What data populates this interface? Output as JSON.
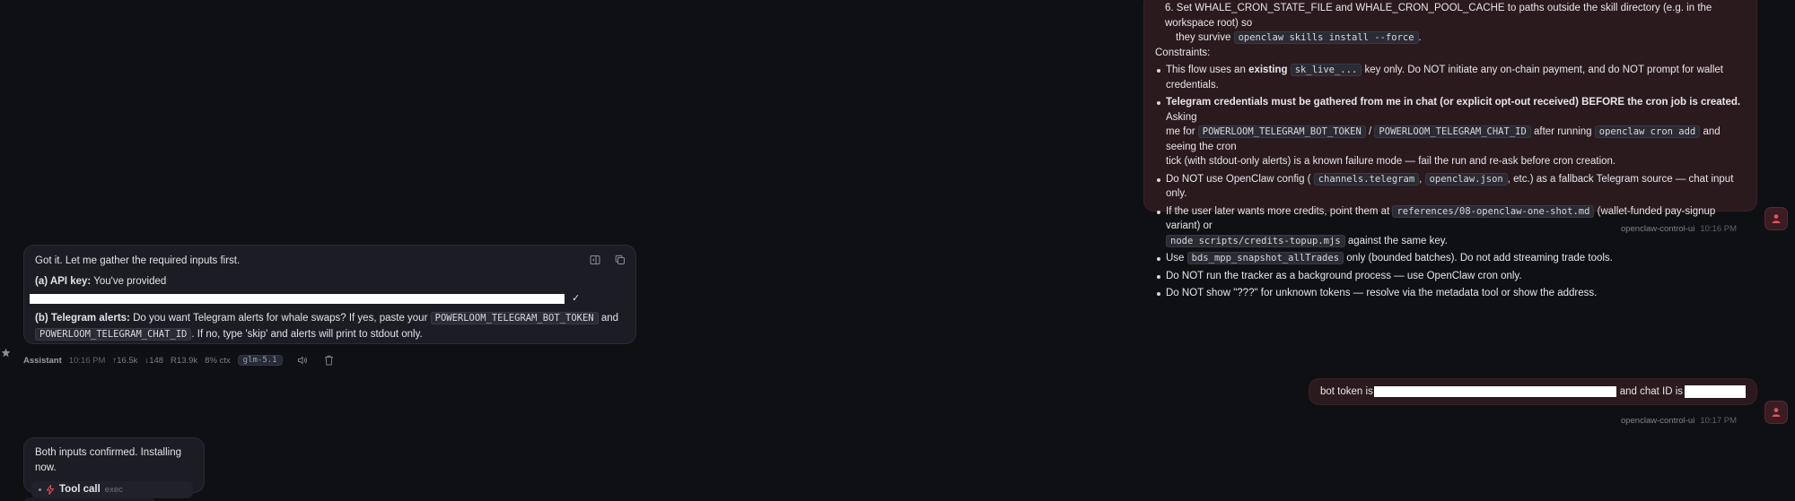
{
  "user_msg_1": {
    "step6_a": "6. Set WHALE_CRON_STATE_FILE and WHALE_CRON_POOL_CACHE to paths outside the skill directory (e.g. in the workspace root) so",
    "step6_b": "they survive",
    "step6_code": "openclaw skills install --force",
    "step6_end": ".",
    "constraints_title": "Constraints:",
    "c1_pre": "This flow uses an",
    "c1_bold": "existing",
    "c1_code": "sk_live_...",
    "c1_post": "key only. Do NOT initiate any on-chain payment, and do NOT prompt for wallet credentials.",
    "c2_bold": "Telegram credentials must be gathered from me in chat (or explicit opt-out received) BEFORE the cron job is created.",
    "c2_post1": "Asking",
    "c2_line2_pre": "me for",
    "c2_code1": "POWERLOOM_TELEGRAM_BOT_TOKEN",
    "c2_sep": "/",
    "c2_code2": "POWERLOOM_TELEGRAM_CHAT_ID",
    "c2_mid": "after running",
    "c2_code3": "openclaw cron add",
    "c2_post2": "and seeing the cron",
    "c2_line3": "tick (with stdout-only alerts) is a known failure mode — fail the run and re-ask before cron creation.",
    "c3_pre": "Do NOT use OpenClaw config (",
    "c3_code1": "channels.telegram",
    "c3_comma": ",",
    "c3_code2": "openclaw.json",
    "c3_post": ", etc.) as a fallback Telegram source — chat input only.",
    "c4_pre": "If the user later wants more credits, point them at",
    "c4_code1": "references/08-openclaw-one-shot.md",
    "c4_mid": "(wallet-funded pay-signup variant) or",
    "c4_code2": "node scripts/credits-topup.mjs",
    "c4_post": "against the same key.",
    "c5_pre": "Use",
    "c5_code": "bds_mpp_snapshot_allTrades",
    "c5_post": "only (bounded batches). Do not add streaming trade tools.",
    "c6": "Do NOT run the tracker as a background process — use OpenClaw cron only.",
    "c7": "Do NOT show \"???\" for unknown tokens — resolve via the metadata tool or show the address.",
    "sender": "openclaw-control-ui",
    "time": "10:16 PM"
  },
  "asst_msg_1": {
    "intro": "Got it. Let me gather the required inputs first.",
    "a_label": "(a) API key:",
    "a_text": "You've provided",
    "check": "✓",
    "b_label": "(b) Telegram alerts:",
    "b_text": "Do you want Telegram alerts for whale swaps? If yes, paste your",
    "b_code1": "POWERLOOM_TELEGRAM_BOT_TOKEN",
    "b_and": "and",
    "b_code2": "POWERLOOM_TELEGRAM_CHAT_ID",
    "b_post": ". If no, type 'skip' and alerts will print to stdout only.",
    "meta": {
      "sender": "Assistant",
      "time": "10:16 PM",
      "up": "↑16.5k",
      "down": "↓148",
      "r": "R13.9k",
      "ctx": "8% ctx",
      "model": "glm-5.1"
    }
  },
  "user_msg_2": {
    "pre": "bot token is",
    "mid": "and chat ID is",
    "sender": "openclaw-control-ui",
    "time": "10:17 PM"
  },
  "asst_msg_2": {
    "text": "Both inputs confirmed. Installing now.",
    "tool_label": "Tool call",
    "tool_kind": "exec"
  },
  "colors": {
    "background": "#0f1014",
    "user_bubble": "#2a1a1e",
    "assistant_bubble": "#1c1d24",
    "accent_red": "#e0525e"
  }
}
